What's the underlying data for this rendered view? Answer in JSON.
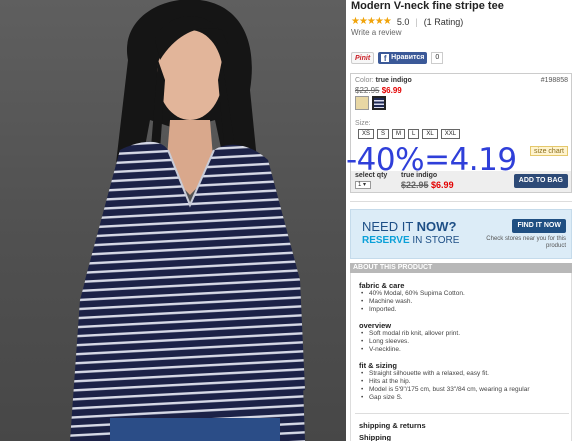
{
  "product": {
    "title": "Modern V-neck fine stripe tee",
    "stars": "★★★★★",
    "rating_value": "5.0",
    "rating_count": "(1 Rating)",
    "write_review": "Write a review"
  },
  "social": {
    "pin_label": "Pinit",
    "fb_icon": "f",
    "fb_label": "Нравится",
    "fb_count": "0"
  },
  "options": {
    "color_label": "Color:",
    "color_value": "true indigo",
    "sku": "#198858",
    "old_price": "$22.95",
    "new_price": "$6.99",
    "swatches": [
      "cream-swatch",
      "indigo-stripe-swatch"
    ],
    "size_label": "Size:",
    "sizes": [
      "XS",
      "S",
      "M",
      "L",
      "XL",
      "XXL"
    ],
    "size_chart": "size chart",
    "qty_label": "select qty",
    "qty_value": "1 ▾",
    "selected_name": "true indigo",
    "selected_old_price": "$22.95",
    "selected_new_price": "$6.99",
    "add_to_bag": "ADD TO BAG"
  },
  "overlay_text": "-40%=4.19",
  "ad": {
    "need_a": "NEED IT ",
    "need_b": "NOW?",
    "reserve_a": "RESERVE",
    "reserve_b": " IN STORE",
    "find_button": "FIND IT NOW",
    "check_text": "Check stores near you for this product"
  },
  "about": {
    "header": "ABOUT THIS PRODUCT",
    "fabric_title": "fabric & care",
    "fabric_items": [
      "40% Modal, 60% Supima Cotton.",
      "Machine wash.",
      "Imported."
    ],
    "overview_title": "overview",
    "overview_items": [
      "Soft modal rib knit, allover print.",
      "Long sleeves.",
      "V-neckline."
    ],
    "fit_title": "fit & sizing",
    "fit_items": [
      "Straight silhouette with a relaxed, easy fit.",
      "Hits at the hip.",
      "Model is 5'9\"/175 cm, bust 33\"/84 cm, wearing a regular",
      "Gap size S."
    ],
    "shipping_title": "shipping & returns",
    "shipping_sub": "Shipping"
  },
  "colors": {
    "price_red": "#e30000",
    "button_blue": "#2d4a77",
    "overlay_blue": "#2f3fd9",
    "star_orange": "#f0a30a"
  }
}
